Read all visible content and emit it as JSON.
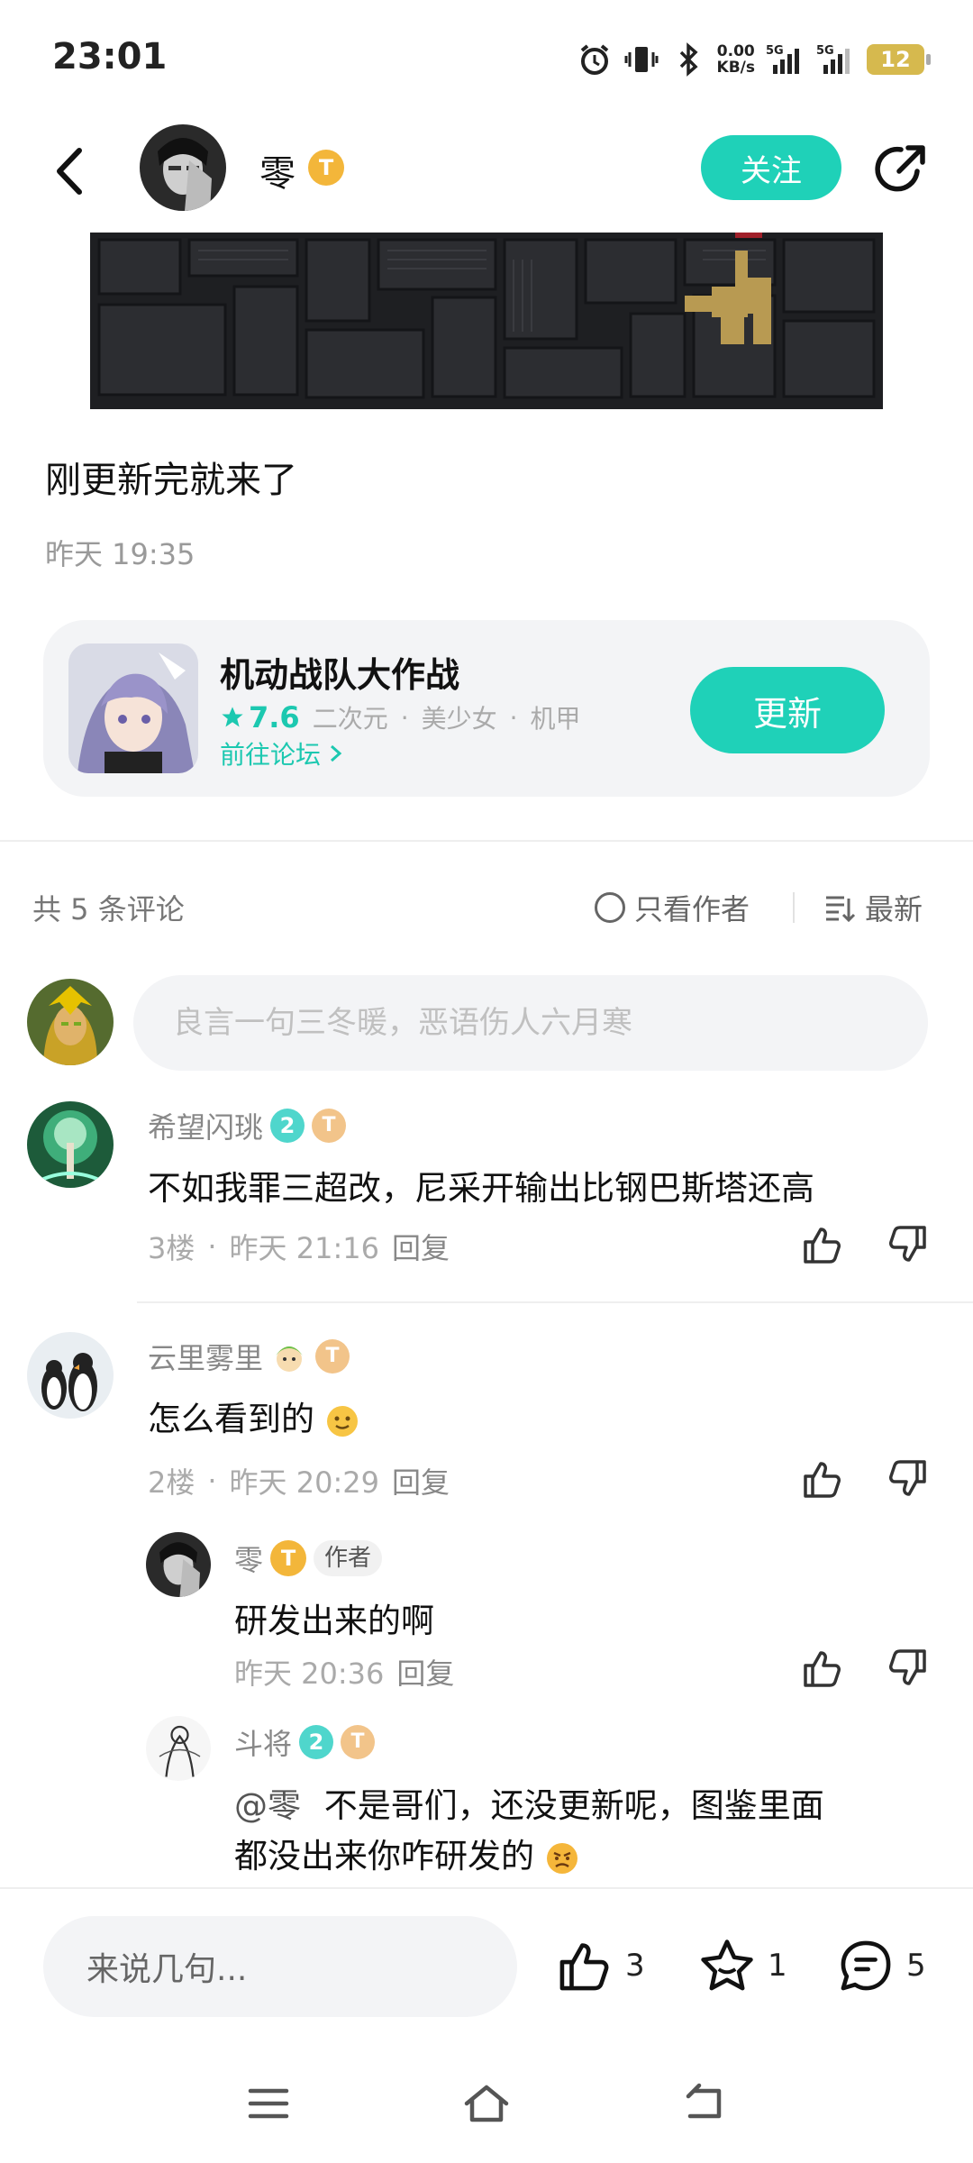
{
  "status_bar": {
    "time": "23:01",
    "speed_value": "0.00",
    "speed_unit": "KB/s",
    "net1": "5G",
    "net2": "5G",
    "battery": "12"
  },
  "header": {
    "username": "零",
    "level_badge": "T",
    "follow_label": "关注"
  },
  "post": {
    "text": "刚更新完就来了",
    "time": "昨天 19:35"
  },
  "game_card": {
    "title": "机动战队大作战",
    "rating": "7.6",
    "tags": [
      "二次元",
      "美少女",
      "机甲"
    ],
    "forum_link": "前往论坛",
    "update_label": "更新"
  },
  "comments_header": {
    "count": "共 5 条评论",
    "only_author": "只看作者",
    "sort": "最新"
  },
  "comment_input": {
    "placeholder": "良言一句三冬暖，恶语伤人六月寒"
  },
  "comments": [
    {
      "name": "希望闪珧",
      "badge1": "2",
      "badge2": "T",
      "text": "不如我罪三超改，尼采开输出比钢巴斯塔还高",
      "floor": "3楼",
      "time": "昨天 21:16",
      "reply": "回复"
    },
    {
      "name": "云里雾里",
      "badge2": "T",
      "text": "怎么看到的",
      "floor": "2楼",
      "time": "昨天 20:29",
      "reply": "回复",
      "replies": [
        {
          "name": "零",
          "badge": "T",
          "author_tag": "作者",
          "text": "研发出来的啊",
          "time": "昨天 20:36",
          "reply": "回复"
        },
        {
          "name": "斗将",
          "badge1": "2",
          "badge2": "T",
          "mention": "@零",
          "text_line1": "不是哥们，还没更新呢，图鉴里面",
          "text_line2": "都没出来你咋研发的"
        }
      ]
    }
  ],
  "bottom_bar": {
    "input_placeholder": "来说几句...",
    "likes": "3",
    "favorites": "1",
    "comments": "5"
  },
  "colors": {
    "accent": "#1fd1b8",
    "gold_badge": "#f3b63a",
    "muted_text": "#9a9a9a"
  }
}
